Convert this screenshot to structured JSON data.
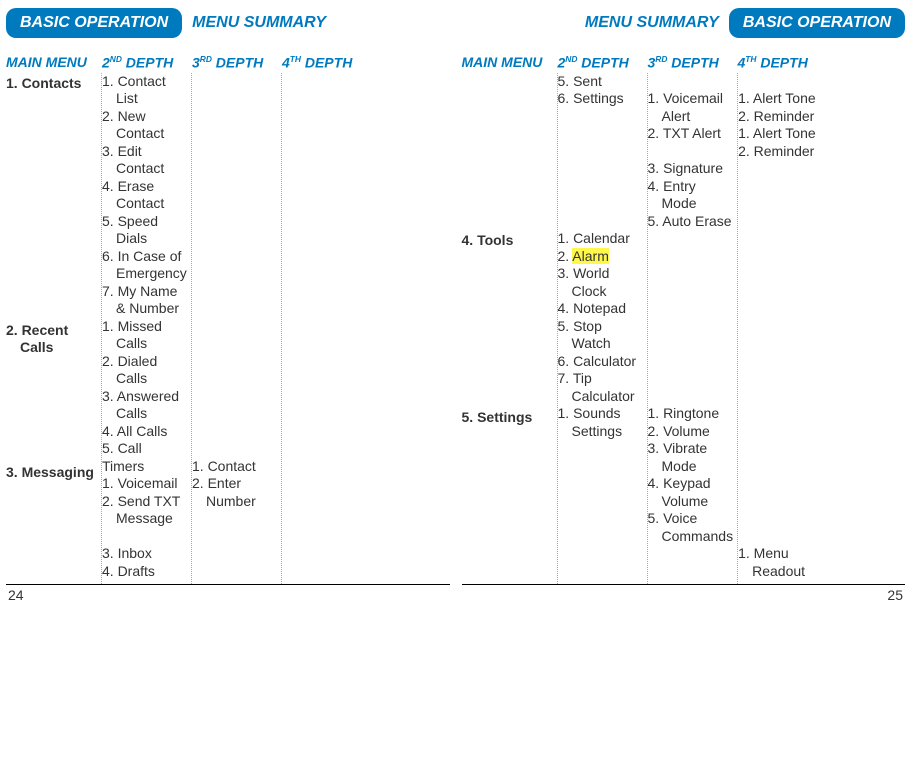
{
  "left": {
    "pillLabel": "BASIC OPERATION",
    "plainLabel": "MENU SUMMARY",
    "cols": [
      "MAIN MENU",
      "2",
      "3",
      "4"
    ],
    "pageNum": "24",
    "rows": [
      {
        "main": "1. Contacts",
        "d2": [
          {
            "n": "1.",
            "t": "Contact",
            "s": "List"
          },
          {
            "n": "2.",
            "t": "New",
            "s": "Contact"
          },
          {
            "n": "3.",
            "t": "Edit",
            "s": "Contact"
          },
          {
            "n": "4.",
            "t": "Erase",
            "s": "Contact"
          },
          {
            "n": "5.",
            "t": "Speed",
            "s": "Dials"
          },
          {
            "n": "6.",
            "t": "In Case of",
            "s": "Emergency"
          },
          {
            "n": "7.",
            "t": "My Name",
            "s": "& Number"
          }
        ],
        "d3": [],
        "d4": []
      },
      {
        "main": "2. Recent",
        "mainSub": "Calls",
        "d2": [
          {
            "n": "1.",
            "t": "Missed",
            "s": "Calls"
          },
          {
            "n": "2.",
            "t": "Dialed",
            "s": "Calls"
          },
          {
            "n": "3.",
            "t": "Answered",
            "s": "Calls"
          },
          {
            "n": "4.",
            "t": "All Calls"
          },
          {
            "n": "5.",
            "t": "Call Timers"
          }
        ],
        "d3": [],
        "d4": []
      },
      {
        "main": "3. Messaging",
        "d2": [
          {
            "n": "1.",
            "t": "Voicemail"
          },
          {
            "n": "2.",
            "t": "Send TXT",
            "s": "Message",
            "sp": 1
          },
          {
            "n": "3.",
            "t": "Inbox"
          },
          {
            "n": "4.",
            "t": "Drafts"
          }
        ],
        "d3": [
          {
            "n": "1.",
            "t": "Contact"
          },
          {
            "n": "2.",
            "t": "Enter",
            "s": "Number"
          }
        ],
        "d4": []
      }
    ]
  },
  "right": {
    "pillLabel": "BASIC OPERATION",
    "plainLabel": "MENU SUMMARY",
    "cols": [
      "MAIN MENU",
      "2",
      "3",
      "4"
    ],
    "pageNum": "25",
    "rows": [
      {
        "main": "",
        "d2": [
          {
            "n": "5.",
            "t": "Sent"
          },
          {
            "n": "6.",
            "t": "Settings"
          }
        ],
        "d3": [
          {
            "sp": 1
          },
          {
            "n": "1.",
            "t": "Voicemail",
            "s": "Alert"
          },
          {
            "n": "2.",
            "t": "TXT Alert",
            "sp": 1
          },
          {
            "n": "3.",
            "t": "Signature"
          },
          {
            "n": "4.",
            "t": "Entry",
            "s": "Mode"
          },
          {
            "n": "5.",
            "t": "Auto Erase"
          }
        ],
        "d4": [
          {
            "sp": 1
          },
          {
            "n": "1.",
            "t": "Alert Tone"
          },
          {
            "n": "2.",
            "t": "Reminder"
          },
          {
            "n": "1.",
            "t": "Alert Tone"
          },
          {
            "n": "2.",
            "t": "Reminder"
          }
        ]
      },
      {
        "main": "4. Tools",
        "d2": [
          {
            "n": "1.",
            "t": "Calendar"
          },
          {
            "n": "2.",
            "t": "Alarm",
            "hl": true
          },
          {
            "n": "3.",
            "t": "World",
            "s": "Clock"
          },
          {
            "n": "4.",
            "t": "Notepad"
          },
          {
            "n": "5.",
            "t": "Stop",
            "s": "Watch"
          },
          {
            "n": "6.",
            "t": "Calculator"
          },
          {
            "n": "7.",
            "t": "Tip",
            "s": "Calculator"
          }
        ],
        "d3": [],
        "d4": []
      },
      {
        "main": "5. Settings",
        "d2": [
          {
            "n": "1.",
            "t": "Sounds",
            "s": "Settings"
          }
        ],
        "d3": [
          {
            "n": "1.",
            "t": "Ringtone"
          },
          {
            "n": "2.",
            "t": "Volume"
          },
          {
            "n": "3.",
            "t": "Vibrate",
            "s": "Mode"
          },
          {
            "n": "4.",
            "t": "Keypad",
            "s": "Volume"
          },
          {
            "n": "5.",
            "t": "Voice",
            "s": "Commands"
          }
        ],
        "d4": [
          {
            "sp": 8
          },
          {
            "n": "1.",
            "t": "Menu",
            "s": "Readout"
          }
        ]
      }
    ]
  },
  "suffix": {
    "nd": "ND",
    "rd": "RD",
    "th": "TH",
    "depth": " DEPTH"
  }
}
